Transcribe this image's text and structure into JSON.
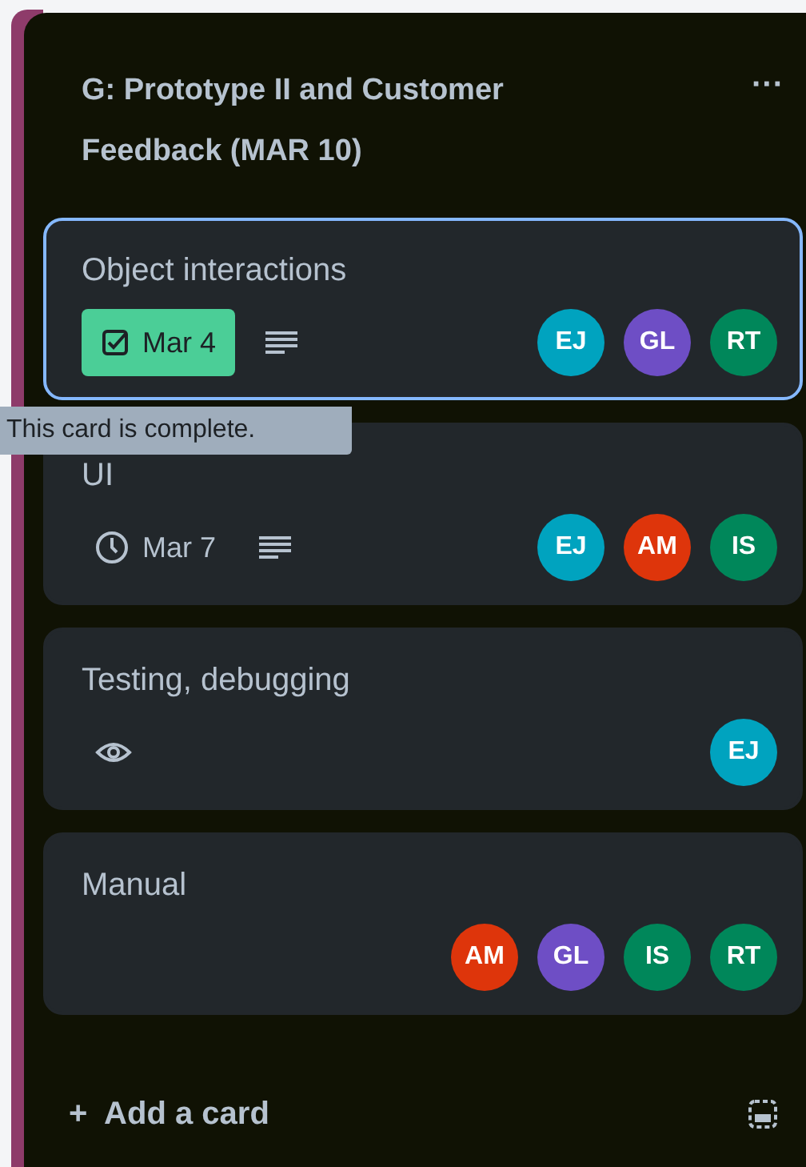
{
  "list": {
    "title": "G: Prototype II and Customer Feedback (MAR 10)",
    "menu": "···"
  },
  "cards": [
    {
      "title": "Object interactions",
      "selected": true,
      "badges": [
        {
          "kind": "due",
          "text": "Mar 4",
          "complete": true
        },
        {
          "kind": "description"
        }
      ],
      "members": [
        {
          "initials": "EJ",
          "color": "#00a3bf"
        },
        {
          "initials": "GL",
          "color": "#6e4ec5"
        },
        {
          "initials": "RT",
          "color": "#00875a"
        }
      ]
    },
    {
      "title": "UI",
      "selected": false,
      "badges": [
        {
          "kind": "due",
          "text": "Mar 7",
          "complete": false
        },
        {
          "kind": "description"
        }
      ],
      "members": [
        {
          "initials": "EJ",
          "color": "#00a3bf"
        },
        {
          "initials": "AM",
          "color": "#de350b"
        },
        {
          "initials": "IS",
          "color": "#00875a"
        }
      ]
    },
    {
      "title": "Testing, debugging",
      "selected": false,
      "badges": [
        {
          "kind": "watching"
        }
      ],
      "members": [
        {
          "initials": "EJ",
          "color": "#00a3bf"
        }
      ]
    },
    {
      "title": "Manual",
      "selected": false,
      "members": [
        {
          "initials": "AM",
          "color": "#de350b"
        },
        {
          "initials": "GL",
          "color": "#6e4ec5"
        },
        {
          "initials": "IS",
          "color": "#00875a"
        },
        {
          "initials": "RT",
          "color": "#00875a"
        }
      ]
    }
  ],
  "tooltip": "This card is complete.",
  "footer": {
    "add_label": "+  Add a card"
  }
}
